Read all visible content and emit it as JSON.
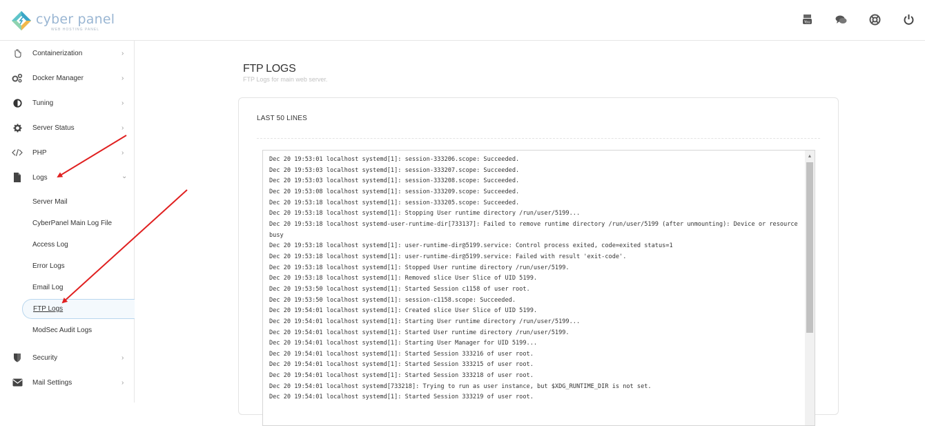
{
  "brand": {
    "name": "cyber panel",
    "subtitle": "WEB HOSTING PANEL"
  },
  "top_icons": [
    "youtube-icon",
    "chat-icon",
    "support-icon",
    "power-icon"
  ],
  "sidebar": {
    "items": [
      {
        "label": "Containerization",
        "icon": "container-icon",
        "chevron": "›"
      },
      {
        "label": "Docker Manager",
        "icon": "gears-icon",
        "chevron": "›"
      },
      {
        "label": "Tuning",
        "icon": "contrast-icon",
        "chevron": "›"
      },
      {
        "label": "Server Status",
        "icon": "gear-icon",
        "chevron": "›"
      },
      {
        "label": "PHP",
        "icon": "code-icon",
        "chevron": "›"
      },
      {
        "label": "Logs",
        "icon": "file-icon",
        "chevron": "⌄"
      },
      {
        "label": "Security",
        "icon": "shield-icon",
        "chevron": "›"
      },
      {
        "label": "Mail Settings",
        "icon": "envelope-icon",
        "chevron": "›"
      }
    ],
    "logs_submenu": [
      "Server Mail",
      "CyberPanel Main Log File",
      "Access Log",
      "Error Logs",
      "Email Log",
      "FTP Logs",
      "ModSec Audit Logs"
    ]
  },
  "page": {
    "title": "FTP LOGS",
    "subtitle": "FTP Logs for main web server."
  },
  "card": {
    "title": "LAST 50 LINES"
  },
  "log_lines": [
    "Dec 20 19:53:01 localhost systemd[1]: session-333206.scope: Succeeded.",
    "Dec 20 19:53:03 localhost systemd[1]: session-333207.scope: Succeeded.",
    "Dec 20 19:53:03 localhost systemd[1]: session-333208.scope: Succeeded.",
    "Dec 20 19:53:08 localhost systemd[1]: session-333209.scope: Succeeded.",
    "Dec 20 19:53:18 localhost systemd[1]: session-333205.scope: Succeeded.",
    "Dec 20 19:53:18 localhost systemd[1]: Stopping User runtime directory /run/user/5199...",
    "Dec 20 19:53:18 localhost systemd-user-runtime-dir[733137]: Failed to remove runtime directory /run/user/5199 (after unmounting): Device or resource busy",
    "Dec 20 19:53:18 localhost systemd[1]: user-runtime-dir@5199.service: Control process exited, code=exited status=1",
    "Dec 20 19:53:18 localhost systemd[1]: user-runtime-dir@5199.service: Failed with result 'exit-code'.",
    "Dec 20 19:53:18 localhost systemd[1]: Stopped User runtime directory /run/user/5199.",
    "Dec 20 19:53:18 localhost systemd[1]: Removed slice User Slice of UID 5199.",
    "Dec 20 19:53:50 localhost systemd[1]: Started Session c1158 of user root.",
    "Dec 20 19:53:50 localhost systemd[1]: session-c1158.scope: Succeeded.",
    "Dec 20 19:54:01 localhost systemd[1]: Created slice User Slice of UID 5199.",
    "Dec 20 19:54:01 localhost systemd[1]: Starting User runtime directory /run/user/5199...",
    "Dec 20 19:54:01 localhost systemd[1]: Started User runtime directory /run/user/5199.",
    "Dec 20 19:54:01 localhost systemd[1]: Starting User Manager for UID 5199...",
    "Dec 20 19:54:01 localhost systemd[1]: Started Session 333216 of user root.",
    "Dec 20 19:54:01 localhost systemd[1]: Started Session 333215 of user root.",
    "Dec 20 19:54:01 localhost systemd[1]: Started Session 333218 of user root.",
    "Dec 20 19:54:01 localhost systemd[733218]: Trying to run as user instance, but $XDG_RUNTIME_DIR is not set.",
    "Dec 20 19:54:01 localhost systemd[1]: Started Session 333219 of user root."
  ],
  "annotation_color": "#e02020",
  "accent_color": "#b8d6ee"
}
